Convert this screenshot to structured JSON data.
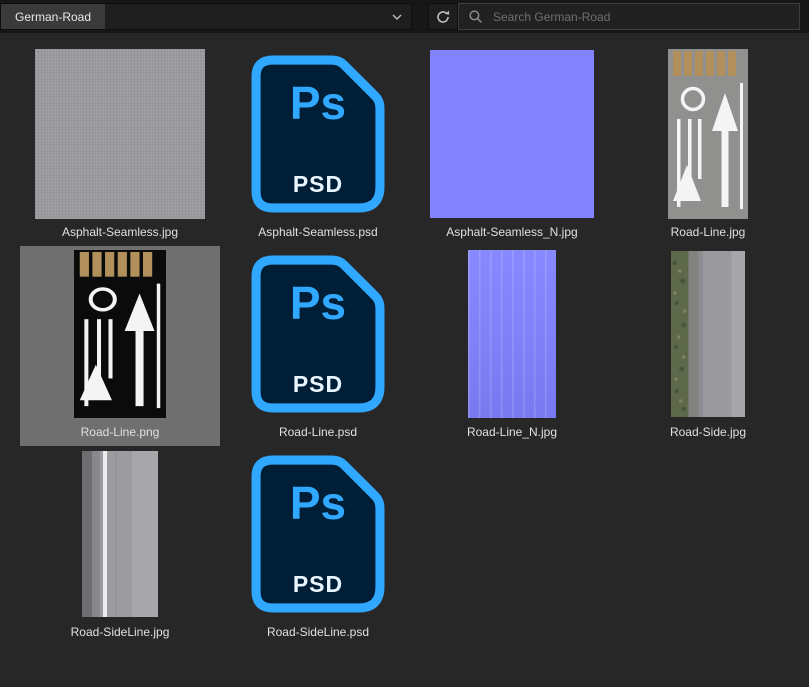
{
  "topbar": {
    "folder": "German-Road",
    "search_placeholder": "Search German-Road"
  },
  "icons": {
    "dropdown": "chevron-down-icon",
    "refresh": "refresh-icon",
    "search": "search-icon"
  },
  "psd_icon": {
    "ps": "Ps",
    "psd": "PSD"
  },
  "colors": {
    "accent_blue": "#31a8ff",
    "psd_background": "#001e36",
    "normal_map_purple": "#8282ff",
    "selection_gray": "#6f6f6f",
    "topbar_bg": "#171717",
    "content_bg": "#272727"
  },
  "items": [
    {
      "name": "Asphalt-Seamless.jpg",
      "type": "asphalt",
      "selected": false
    },
    {
      "name": "Asphalt-Seamless.psd",
      "type": "psd",
      "selected": false
    },
    {
      "name": "Asphalt-Seamless_N.jpg",
      "type": "normal-square",
      "selected": false
    },
    {
      "name": "Road-Line.jpg",
      "type": "roadline-light",
      "selected": false
    },
    {
      "name": "Road-Line.png",
      "type": "roadline-dark",
      "selected": true
    },
    {
      "name": "Road-Line.psd",
      "type": "psd",
      "selected": false
    },
    {
      "name": "Road-Line_N.jpg",
      "type": "normal-tall",
      "selected": false
    },
    {
      "name": "Road-Side.jpg",
      "type": "roadside",
      "selected": false
    },
    {
      "name": "Road-SideLine.jpg",
      "type": "roadsideline",
      "selected": false
    },
    {
      "name": "Road-SideLine.psd",
      "type": "psd",
      "selected": false
    }
  ]
}
